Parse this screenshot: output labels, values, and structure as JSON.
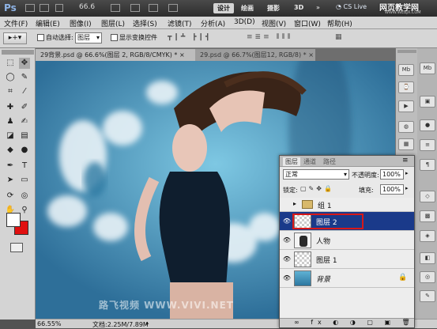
{
  "appbar": {
    "logo": "Ps",
    "zoom": "66.6",
    "mode_buttons": [
      "设计",
      "绘画",
      "摄影",
      "3D"
    ],
    "cslive": "CS Live",
    "watermark": "网页教学网",
    "watermark_url": "WWW.WEBJX.COM"
  },
  "menu": [
    "文件(F)",
    "编辑(E)",
    "图像(I)",
    "图层(L)",
    "选择(S)",
    "滤镜(T)",
    "分析(A)",
    "3D(D)",
    "视图(V)",
    "窗口(W)",
    "帮助(H)"
  ],
  "options": {
    "auto_select_label": "自动选择:",
    "auto_select_value": "图层",
    "show_transform_label": "显示变换控件"
  },
  "tabs": [
    {
      "label": "29背景.psd @ 66.6%(图层 2, RGB/8/CMYK) *",
      "close": "×"
    },
    {
      "label": "29.psd @ 66.7%(图层12, RGB/8) *",
      "close": "×"
    }
  ],
  "status": {
    "zoom": "66.55%",
    "doc": "文档:2.25M/7.89M"
  },
  "canvas_watermark": "路飞视频  WWW.VIVI.NET",
  "layers_panel": {
    "tabs": [
      "图层",
      "通道",
      "路径"
    ],
    "blend_mode": "正常",
    "opacity_label": "不透明度:",
    "opacity_value": "100%",
    "lock_label": "锁定:",
    "fill_label": "填充:",
    "fill_value": "100%",
    "layers": [
      {
        "name": "组 1",
        "type": "group",
        "selected": false
      },
      {
        "name": "图层 2",
        "type": "layer",
        "selected": true
      },
      {
        "name": "人物",
        "type": "layer",
        "selected": false
      },
      {
        "name": "图层 1",
        "type": "layer",
        "selected": false
      },
      {
        "name": "背景",
        "type": "background",
        "selected": false
      }
    ]
  },
  "colors": {
    "accent": "#1a3a8a",
    "selection_border": "#d81818"
  }
}
